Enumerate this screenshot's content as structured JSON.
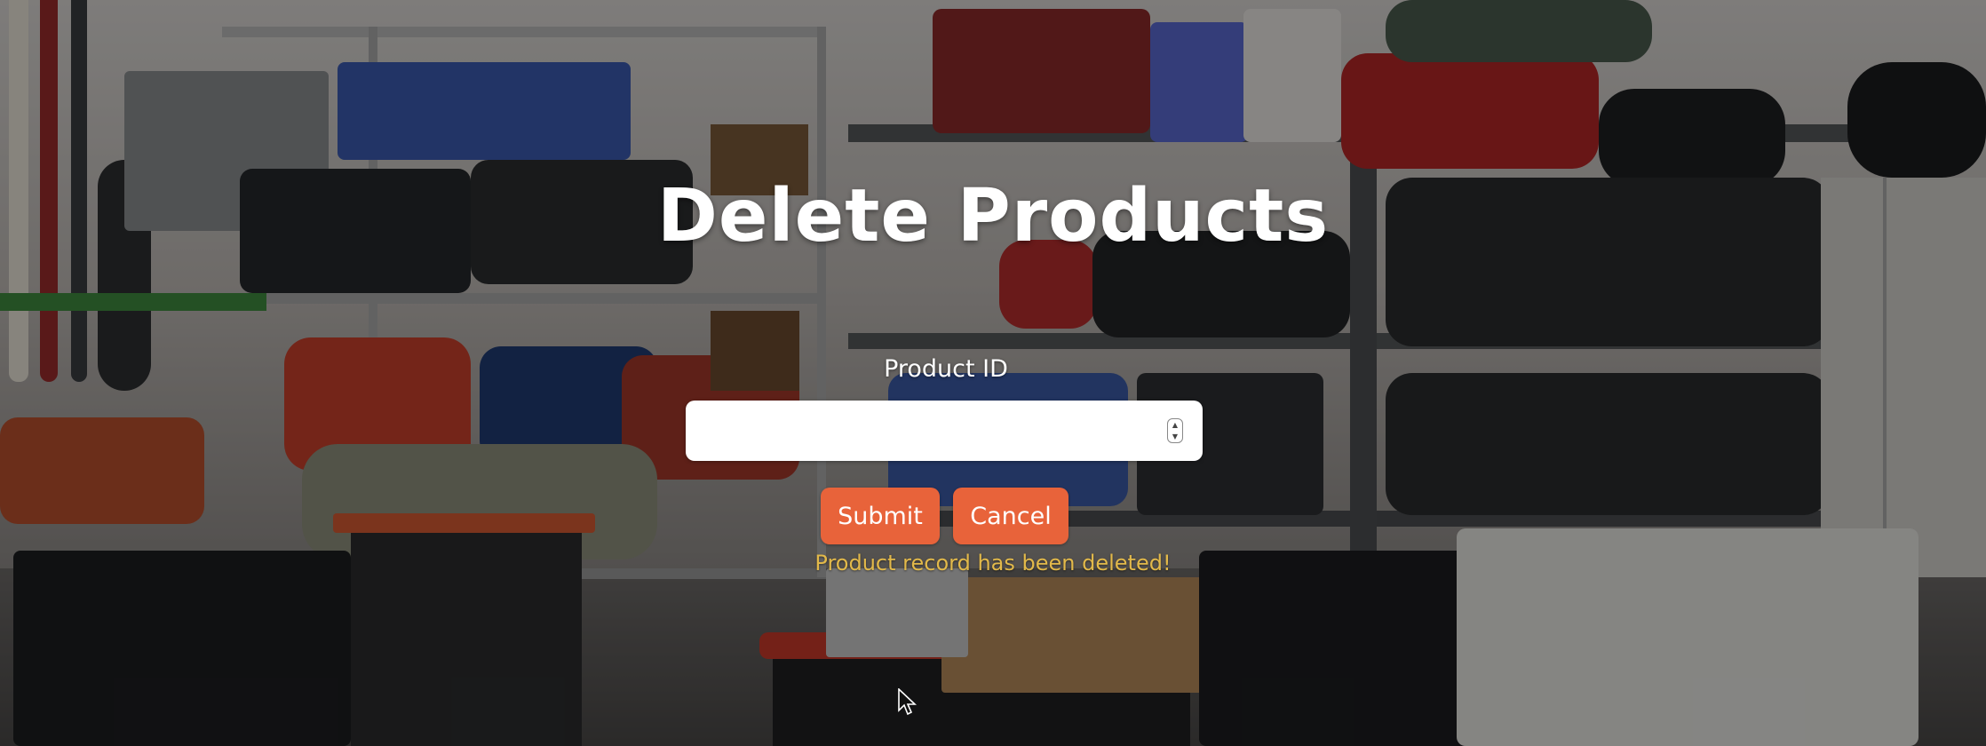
{
  "page": {
    "title": "Delete Products"
  },
  "form": {
    "product_id": {
      "label": "Product ID",
      "value": "",
      "placeholder": ""
    },
    "submit_label": "Submit",
    "cancel_label": "Cancel",
    "status_message": "Product record has been deleted!"
  },
  "colors": {
    "button": "#e8633a",
    "status": "#e2b94a",
    "title": "#ffffff"
  },
  "icons": {
    "stepper": "number-stepper-icon",
    "cursor": "mouse-pointer-icon"
  }
}
